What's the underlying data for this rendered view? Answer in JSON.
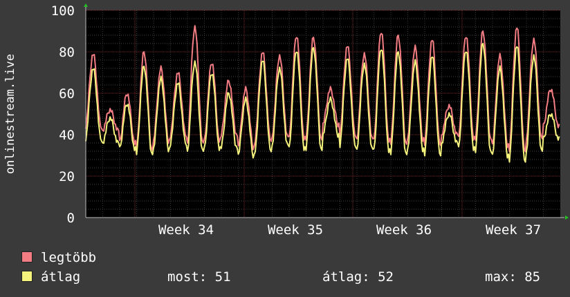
{
  "chart_data": {
    "type": "line",
    "ylabel": "onlinestream.live",
    "ylim": [
      0,
      100
    ],
    "yticks": [
      0,
      20,
      40,
      60,
      80,
      100
    ],
    "xticks": [
      "Week 34",
      "Week 35",
      "Week 36",
      "Week 37"
    ],
    "grid": true,
    "series": [
      {
        "name": "legtöbb",
        "color": "#f47d84",
        "peaks": [
          79,
          52,
          60,
          80,
          72,
          70,
          92,
          75,
          66,
          62,
          80,
          78,
          88,
          87,
          62,
          83,
          79,
          90,
          88,
          82,
          86,
          54,
          88,
          90,
          78,
          92,
          86,
          62
        ],
        "troughs": [
          44,
          42,
          36,
          33,
          37,
          40,
          36,
          37,
          40,
          34,
          38,
          39,
          38,
          38,
          45,
          40,
          38,
          37,
          36,
          38,
          36,
          40,
          38,
          38,
          35,
          33,
          38,
          44
        ]
      },
      {
        "name": "átlag",
        "color": "#f6f37c",
        "peaks": [
          72,
          48,
          55,
          73,
          67,
          65,
          75,
          70,
          60,
          57,
          76,
          72,
          81,
          82,
          57,
          77,
          74,
          82,
          80,
          75,
          78,
          50,
          81,
          84,
          72,
          83,
          78,
          50
        ],
        "troughs": [
          38,
          36,
          33,
          31,
          33,
          36,
          32,
          33,
          34,
          30,
          33,
          35,
          33,
          33,
          40,
          35,
          33,
          32,
          31,
          33,
          31,
          36,
          33,
          32,
          30,
          28,
          32,
          38
        ]
      }
    ],
    "background_color": "#000000",
    "grid_color": "#7a2a2a"
  },
  "legend": [
    {
      "label": "legtöbb",
      "color": "#f47d84"
    },
    {
      "label": "átlag",
      "color": "#f6f37c"
    }
  ],
  "stats": {
    "most": "most: 51",
    "atlag": "átlag: 52",
    "max": "max: 85"
  }
}
